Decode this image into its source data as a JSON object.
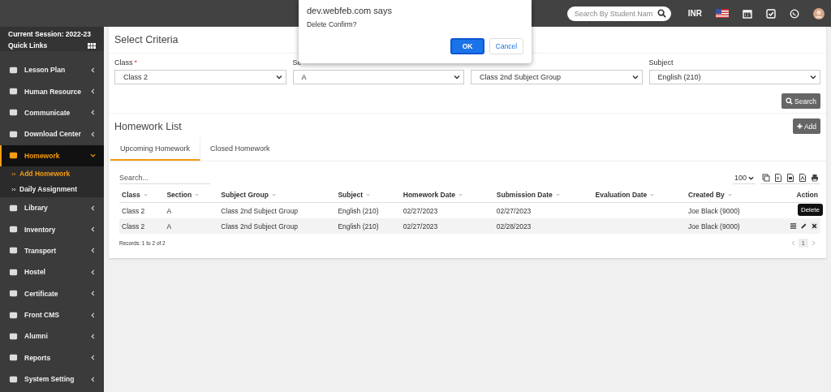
{
  "topbar": {
    "search_placeholder": "Search By Student Nam",
    "currency": "INR"
  },
  "sidebar": {
    "session": "Current Session: 2022-23",
    "quick_links": "Quick Links",
    "items": [
      {
        "label": "Lesson Plan",
        "selected": false,
        "expanded": false
      },
      {
        "label": "Human Resource",
        "selected": false,
        "expanded": false
      },
      {
        "label": "Communicate",
        "selected": false,
        "expanded": false
      },
      {
        "label": "Download Center",
        "selected": false,
        "expanded": false
      },
      {
        "label": "Homework",
        "selected": true,
        "expanded": true,
        "children": [
          {
            "label": "Add Homework",
            "selected": true
          },
          {
            "label": "Daily Assignment",
            "selected": false
          }
        ]
      },
      {
        "label": "Library",
        "selected": false,
        "expanded": false
      },
      {
        "label": "Inventory",
        "selected": false,
        "expanded": false
      },
      {
        "label": "Transport",
        "selected": false,
        "expanded": false
      },
      {
        "label": "Hostel",
        "selected": false,
        "expanded": false
      },
      {
        "label": "Certificate",
        "selected": false,
        "expanded": false
      },
      {
        "label": "Front CMS",
        "selected": false,
        "expanded": false
      },
      {
        "label": "Alumni",
        "selected": false,
        "expanded": false
      },
      {
        "label": "Reports",
        "selected": false,
        "expanded": false
      },
      {
        "label": "System Setting",
        "selected": false,
        "expanded": false
      }
    ]
  },
  "criteria": {
    "title": "Select Criteria",
    "fields": [
      {
        "label": "Class",
        "required": true,
        "value": "Class 2"
      },
      {
        "label": "Se",
        "required": false,
        "value": "A"
      },
      {
        "required": false,
        "value": "Class 2nd Subject Group"
      },
      {
        "label": "Subject",
        "required": false,
        "value": "English (210)"
      }
    ],
    "required_mark": "*",
    "search_button": "Search"
  },
  "homework": {
    "title": "Homework List",
    "add_button": "Add",
    "tabs": [
      {
        "label": "Upcoming Homework",
        "selected": true
      },
      {
        "label": "Closed Homework",
        "selected": false
      }
    ],
    "search_placeholder": "Search...",
    "page_length": "100",
    "columns": [
      "Class",
      "Section",
      "Subject Group",
      "Subject",
      "Homework Date",
      "Submission Date",
      "Evaluation Date",
      "Created By",
      "Action"
    ],
    "rows": [
      {
        "cells": [
          "Class 2",
          "A",
          "Class 2nd Subject Group",
          "English (210)",
          "02/27/2023",
          "02/27/2023",
          "",
          "Joe Black (9000)"
        ]
      },
      {
        "cells": [
          "Class 2",
          "A",
          "Class 2nd Subject Group",
          "English (210)",
          "02/27/2023",
          "02/28/2023",
          "",
          "Joe Black (9000)"
        ]
      }
    ],
    "tooltip": "Delete",
    "records": "Records: 1 to 2 of 2",
    "page": "1"
  },
  "dialog": {
    "title": "dev.webfeb.com says",
    "message": "Delete Confirm?",
    "ok": "OK",
    "cancel": "Cancel"
  }
}
